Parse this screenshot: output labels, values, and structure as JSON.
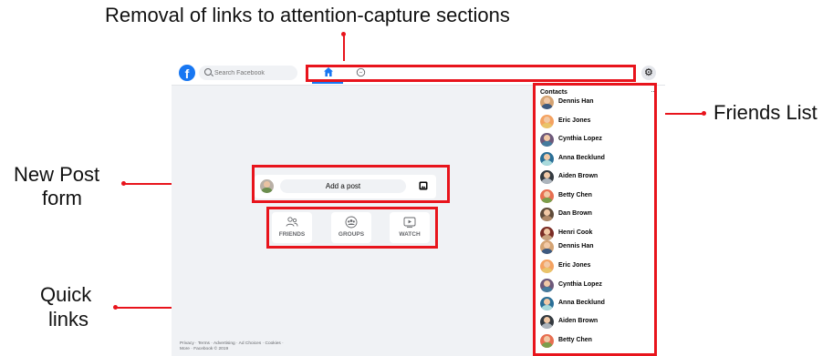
{
  "annotations": {
    "top": "Removal of links to attention-capture sections",
    "friends": "Friends List",
    "new_post_line1": "New Post",
    "new_post_line2": "form",
    "quick_line1": "Quick",
    "quick_line2": "links"
  },
  "header": {
    "logo": "f",
    "search_placeholder": "Search Facebook",
    "nav_icons": [
      "home-icon",
      "messenger-icon"
    ],
    "settings_icon": "gear-icon",
    "settings_glyph": "⚙"
  },
  "post": {
    "placeholder": "Add a post",
    "photo_icon": "photo-icon"
  },
  "quick_links": [
    {
      "label": "FRIENDS",
      "icon": "friends-icon"
    },
    {
      "label": "GROUPS",
      "icon": "groups-icon"
    },
    {
      "label": "WATCH",
      "icon": "watch-icon"
    }
  ],
  "contacts": {
    "title": "Contacts",
    "more": "···",
    "items": [
      {
        "name": "Dennis Han"
      },
      {
        "name": "Eric Jones"
      },
      {
        "name": "Cynthia Lopez"
      },
      {
        "name": "Anna Becklund"
      },
      {
        "name": "Aiden Brown"
      },
      {
        "name": "Betty Chen"
      },
      {
        "name": "Dan Brown"
      },
      {
        "name": "Henri Cook"
      },
      {
        "name": "Dennis Han"
      },
      {
        "name": "Eric Jones"
      },
      {
        "name": "Cynthia Lopez"
      },
      {
        "name": "Anna Becklund"
      },
      {
        "name": "Aiden Brown"
      },
      {
        "name": "Betty Chen"
      }
    ]
  },
  "footer": {
    "line1": "Privacy · Terms · Advertising · Ad Choices · Cookies ·",
    "line2": "More · Facebook © 2019"
  },
  "colors": {
    "annotation_red": "#e8141c",
    "facebook_blue": "#1877f2",
    "background": "#f0f2f5"
  }
}
